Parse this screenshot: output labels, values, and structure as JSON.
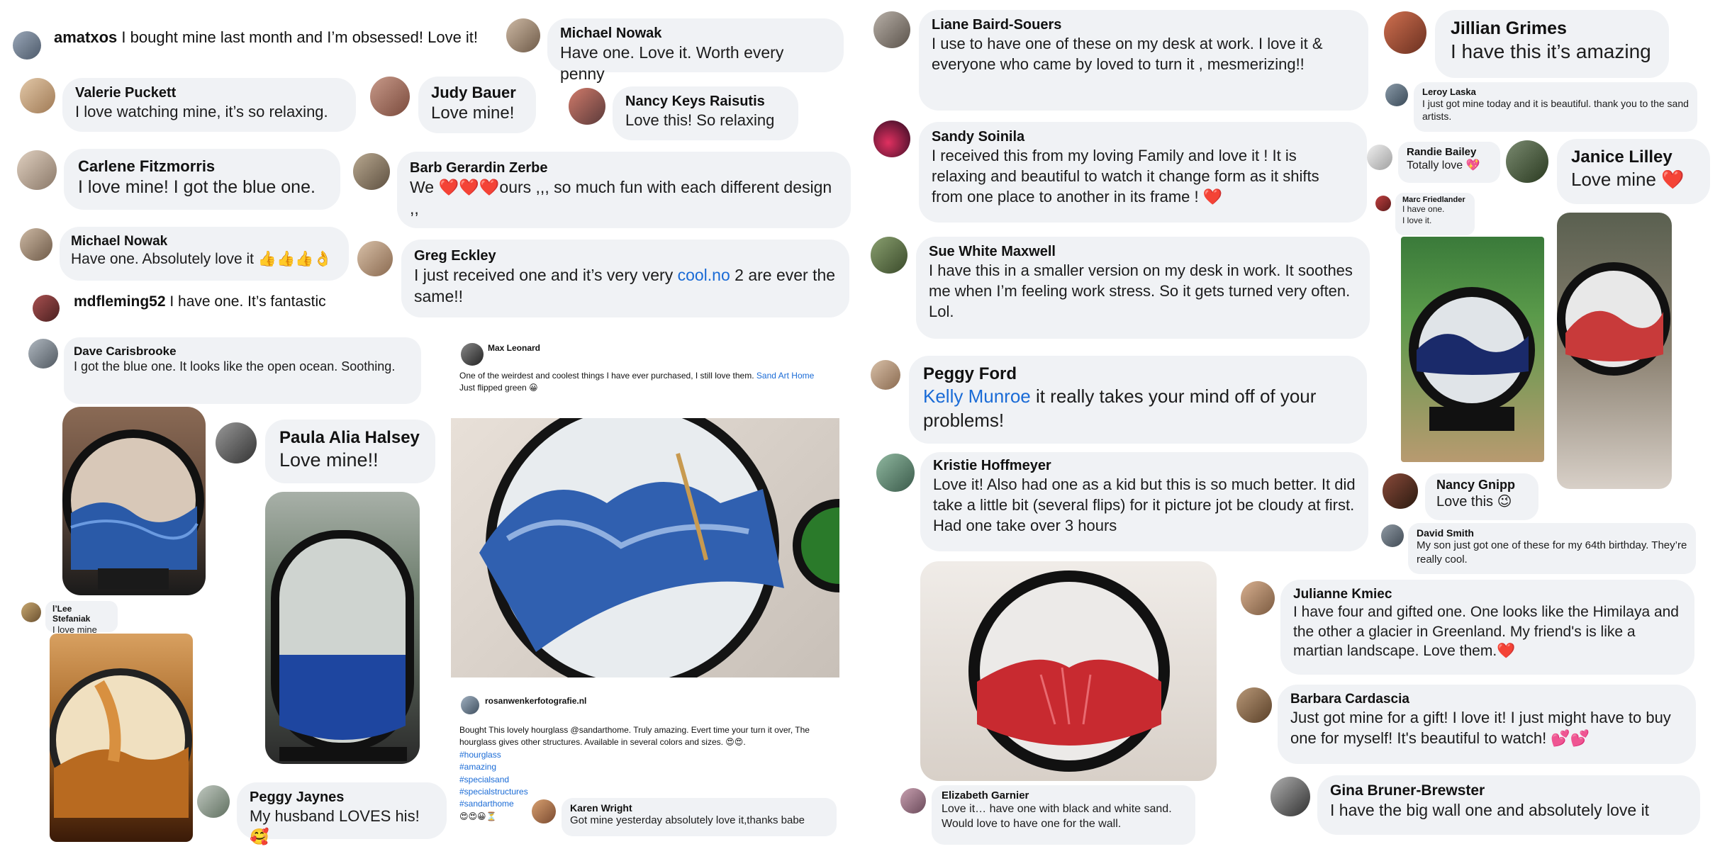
{
  "comments": {
    "amatxos": {
      "name": "amatxos",
      "text": "I bought mine last month and I’m obsessed! Love it!"
    },
    "michael_nowak_1": {
      "name": "Michael Nowak",
      "text": "Have one. Love it. Worth every penny"
    },
    "valerie": {
      "name": "Valerie Puckett",
      "text": "I love watching mine, it’s so relaxing."
    },
    "judy": {
      "name": "Judy Bauer",
      "text": "Love mine!"
    },
    "nancy_keys": {
      "name": "Nancy Keys Raisutis",
      "text": "Love this! So relaxing"
    },
    "carlene": {
      "name": "Carlene Fitzmorris",
      "text": "I love mine! I got the blue one."
    },
    "barb": {
      "name": "Barb Gerardin Zerbe",
      "text_pre": "We ",
      "hearts": "❤️❤️❤️",
      "text_post": "ours ,,, so much fun with each different design ,,"
    },
    "michael_nowak_2": {
      "name": "Michael Nowak",
      "text": "Have one. Absolutely love it 👍👍👍👌"
    },
    "greg": {
      "name": "Greg Eckley",
      "text_pre": "I just received one and it’s very very ",
      "link": "cool.no",
      "text_post": " 2 are ever the same!!"
    },
    "mdfleming": {
      "name": "mdfleming52",
      "text": "I have one. It’s fantastic"
    },
    "dave": {
      "name": "Dave Carisbrooke",
      "text": "I got the blue one. It looks like the open ocean. Soothing."
    },
    "paula": {
      "name": "Paula Alia Halsey",
      "text": "Love mine!!"
    },
    "max": {
      "name": "Max Leonard",
      "text_pre": "One of the weirdest and coolest things I have ever purchased, I still love them. ",
      "link": "Sand Art Home",
      "text_post": "Just flipped green 😀"
    },
    "lee": {
      "name": "l’Lee Stefaniak",
      "text": "I love mine 🥰"
    },
    "rosan": {
      "name": "rosanwenkerfotografie.nl",
      "text": "Bought This lovely hourglass @sandarthome. Truly amazing. Evert time your turn it over, The hourglass gives other structures. Available in several colors and sizes. 😍😍.",
      "hashtags": [
        "#hourglass",
        "#amazing",
        "#specialsand",
        "#specialstructures",
        "#sandarthome"
      ],
      "emojis": "😍😍😀⏳"
    },
    "peggy_j": {
      "name": "Peggy Jaynes",
      "text": "My husband LOVES his! 🥰"
    },
    "karen": {
      "name": "Karen Wright",
      "text": "Got mine yesterday absolutely love it,thanks babe"
    },
    "liane": {
      "name": "Liane Baird-Souers",
      "text": "I use to have one of these on my desk at work. I love it & everyone who came by loved to turn it , mesmerizing!!"
    },
    "sandy": {
      "name": "Sandy Soinila",
      "text": "I received this from my loving Family and love it ! It is relaxing and beautiful to watch it change form as it shifts from one place to another in its frame ! ❤️"
    },
    "sue": {
      "name": "Sue White Maxwell",
      "text": "I have this in a smaller version on my desk in work. It soothes me when I’m feeling work stress. So it gets turned very often. Lol."
    },
    "peggy_f": {
      "name": "Peggy Ford",
      "link": "Kelly Munroe",
      "text": " it really takes your mind off of your problems!"
    },
    "kristie": {
      "name": "Kristie Hoffmeyer",
      "text": "Love it! Also had one as a kid but this is so much better. It did take a little bit (several flips) for it picture jot be cloudy at first. Had one take over 3 hours"
    },
    "elizabeth": {
      "name": "Elizabeth Garnier",
      "text": "Love it… have one with black and white sand. Would love to have one for the wall."
    },
    "jillian": {
      "name": "Jillian Grimes",
      "text": "I have this it’s amazing"
    },
    "leroy": {
      "name": "Leroy Laska",
      "text": "I just got mine today and it is beautiful. thank you to the sand artists."
    },
    "randie": {
      "name": "Randie Bailey",
      "text": "Totally love 💖"
    },
    "janice": {
      "name": "Janice Lilley",
      "text": "Love mine ❤️"
    },
    "marc": {
      "name": "Marc Friedlander",
      "text_line1": "I have one.",
      "text_line2": "I love it."
    },
    "nancy_g": {
      "name": "Nancy Gnipp",
      "text": "Love this 😉"
    },
    "david": {
      "name": "David Smith",
      "text": "My son just got one of these for my 64th birthday. They’re really cool."
    },
    "julianne": {
      "name": "Julianne Kmiec",
      "text": "I have four and gifted one. One looks like the Himilaya and the other a glacier in Greenland. My friend's is like a martian landscape. Love them.❤️"
    },
    "barbara": {
      "name": "Barbara Cardascia",
      "text": "Just got mine for a gift! I love it! I just might have to buy one for myself! It's beautiful to watch! 💕💕"
    },
    "gina": {
      "name": "Gina Bruner-Brewster",
      "text": "I have the big wall one and absolutely love it"
    }
  },
  "colors": {
    "bubble": "#f0f2f5",
    "link": "#1a6bd6",
    "heart": "#e0202a"
  }
}
